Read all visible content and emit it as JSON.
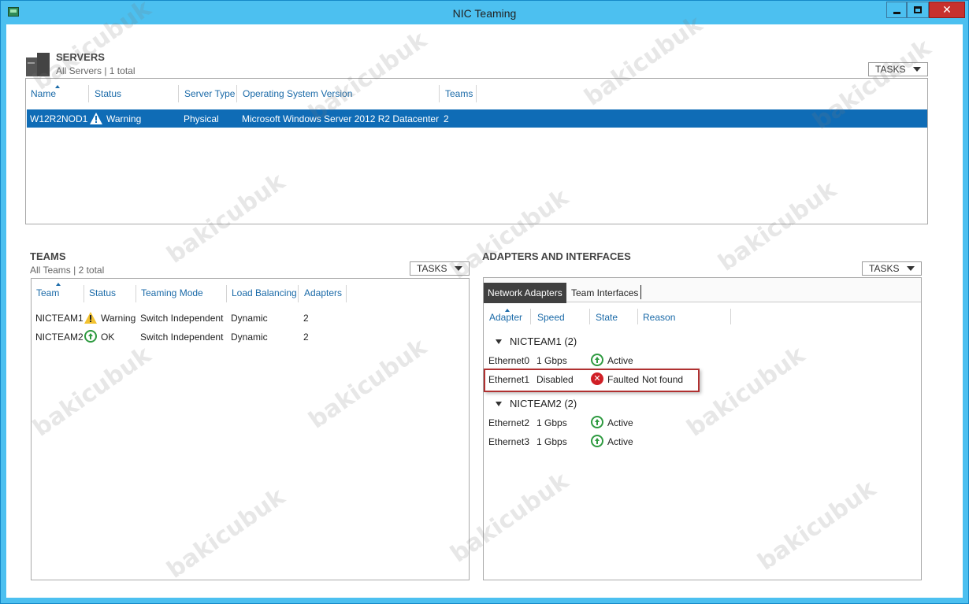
{
  "window": {
    "title": "NIC Teaming"
  },
  "servers": {
    "title": "SERVERS",
    "subtitle": "All Servers | 1 total",
    "tasks_label": "TASKS",
    "columns": [
      "Name",
      "Status",
      "Server Type",
      "Operating System Version",
      "Teams"
    ],
    "rows": [
      {
        "name": "W12R2NOD1",
        "status": "Warning",
        "status_icon": "warning-icon",
        "server_type": "Physical",
        "os": "Microsoft Windows Server 2012 R2 Datacenter",
        "teams": "2"
      }
    ]
  },
  "teams": {
    "title": "TEAMS",
    "subtitle": "All Teams | 2 total",
    "tasks_label": "TASKS",
    "columns": [
      "Team",
      "Status",
      "Teaming Mode",
      "Load Balancing",
      "Adapters"
    ],
    "rows": [
      {
        "team": "NICTEAM1",
        "status": "Warning",
        "status_icon": "warning-icon",
        "mode": "Switch Independent",
        "lb": "Dynamic",
        "adapters": "2"
      },
      {
        "team": "NICTEAM2",
        "status": "OK",
        "status_icon": "ok-icon",
        "mode": "Switch Independent",
        "lb": "Dynamic",
        "adapters": "2"
      }
    ]
  },
  "adapters": {
    "title": "ADAPTERS AND INTERFACES",
    "tasks_label": "TASKS",
    "tabs": [
      "Network Adapters",
      "Team Interfaces"
    ],
    "columns": [
      "Adapter",
      "Speed",
      "State",
      "Reason"
    ],
    "groups": [
      {
        "label": "NICTEAM1 (2)",
        "rows": [
          {
            "adapter": "Ethernet0",
            "speed": "1 Gbps",
            "state": "Active",
            "state_icon": "ok-icon",
            "reason": ""
          },
          {
            "adapter": "Ethernet1",
            "speed": "Disabled",
            "state": "Faulted",
            "state_icon": "error-icon",
            "reason": "Not found"
          }
        ]
      },
      {
        "label": "NICTEAM2 (2)",
        "rows": [
          {
            "adapter": "Ethernet2",
            "speed": "1 Gbps",
            "state": "Active",
            "state_icon": "ok-icon",
            "reason": ""
          },
          {
            "adapter": "Ethernet3",
            "speed": "1 Gbps",
            "state": "Active",
            "state_icon": "ok-icon",
            "reason": ""
          }
        ]
      }
    ]
  },
  "watermark": "bakicubuk",
  "colors": {
    "titlebar": "#4cc0f0",
    "selection": "#0f6cb6",
    "header_text": "#1a6aa8",
    "close_button": "#c7312e",
    "warning": "#f2c230",
    "ok": "#2e9a40",
    "error": "#d01f26"
  }
}
